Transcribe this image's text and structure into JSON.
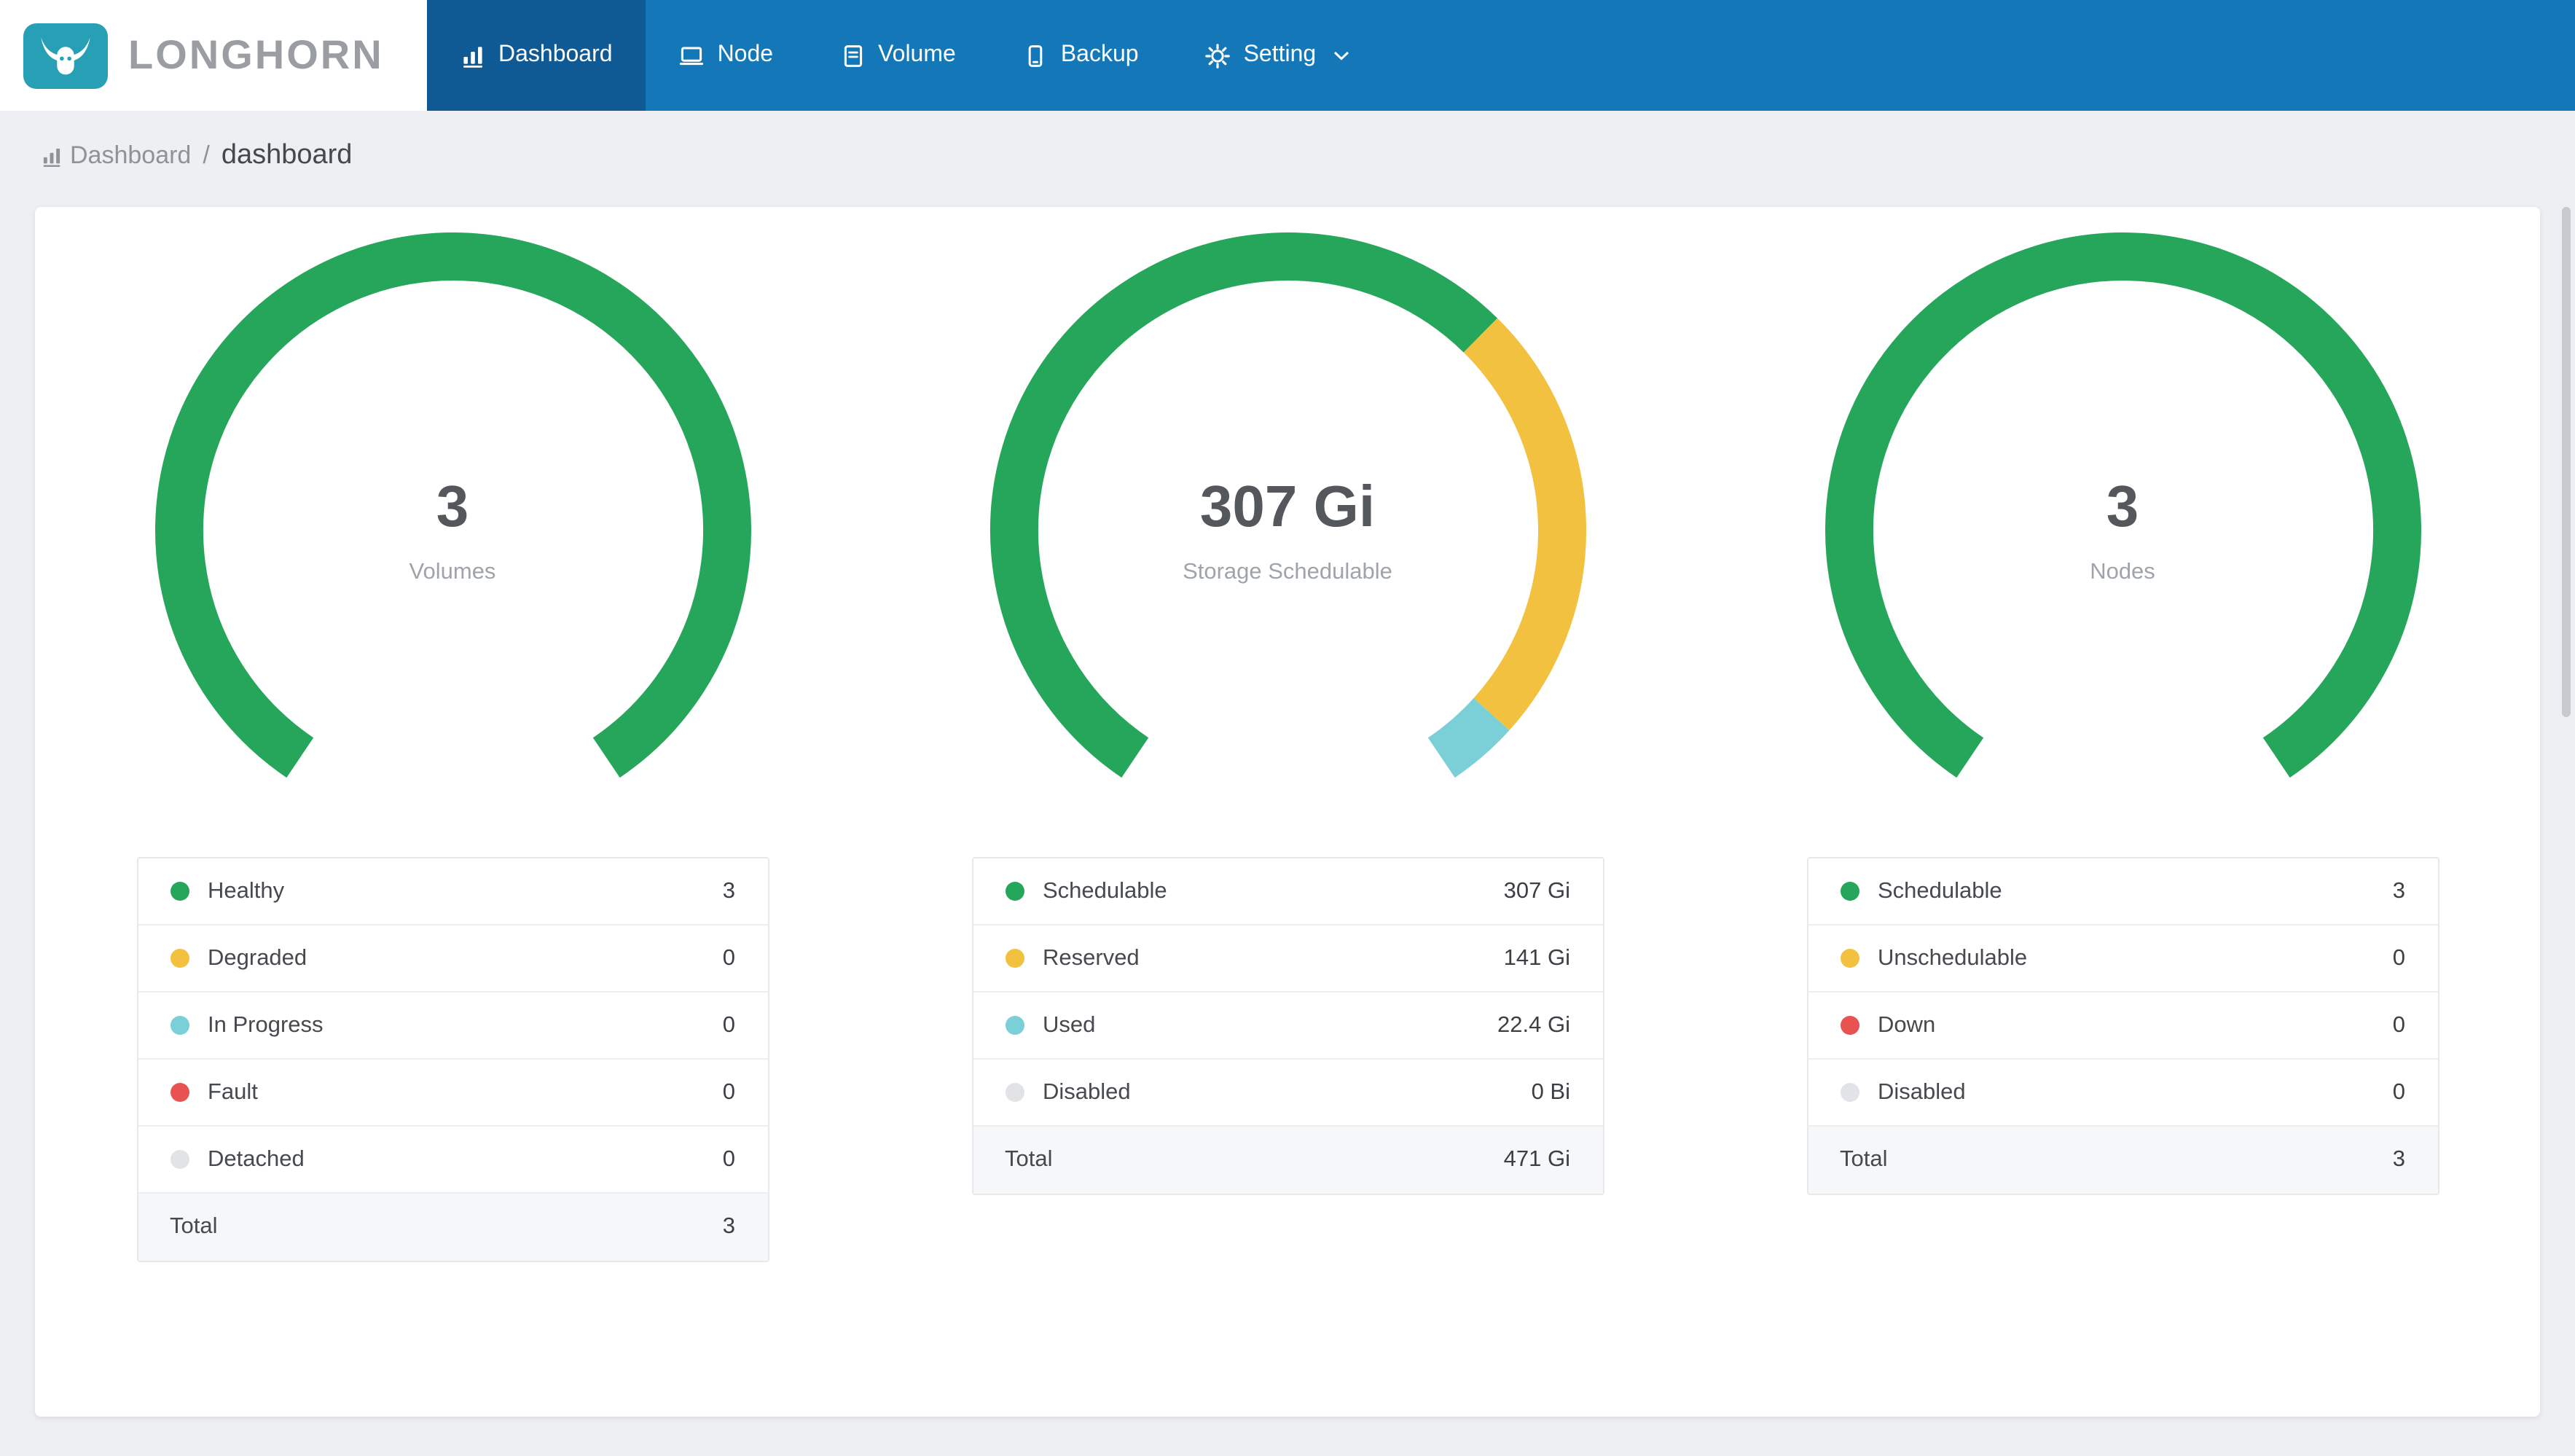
{
  "brand": {
    "name": "LONGHORN"
  },
  "nav": {
    "items": [
      {
        "label": "Dashboard",
        "icon": "bar-chart-icon",
        "active": true
      },
      {
        "label": "Node",
        "icon": "node-icon",
        "active": false
      },
      {
        "label": "Volume",
        "icon": "volume-icon",
        "active": false
      },
      {
        "label": "Backup",
        "icon": "backup-icon",
        "active": false
      },
      {
        "label": "Setting",
        "icon": "gear-icon",
        "active": false,
        "has_dropdown": true
      }
    ]
  },
  "breadcrumb": {
    "section": "Dashboard",
    "separator": "/",
    "page": "dashboard"
  },
  "palette": {
    "green": "#26A65B",
    "yellow": "#F2C140",
    "teal": "#7BCFD6",
    "red": "#E85351",
    "gray": "#E2E3E7",
    "nav_blue": "#1478B8",
    "nav_active_blue": "#0F5A94",
    "logo_teal": "#279FB5"
  },
  "chart_data": [
    {
      "type": "gauge-donut",
      "title": "Volumes",
      "center_value": "3",
      "center_label": "Volumes",
      "gap_degrees": 68,
      "segments": [
        {
          "label": "Healthy",
          "color": "green",
          "value": 3
        },
        {
          "label": "Degraded",
          "color": "yellow",
          "value": 0
        },
        {
          "label": "In Progress",
          "color": "teal",
          "value": 0
        },
        {
          "label": "Fault",
          "color": "red",
          "value": 0
        },
        {
          "label": "Detached",
          "color": "gray",
          "value": 0
        }
      ],
      "legend": [
        {
          "label": "Healthy",
          "color": "green",
          "value": "3"
        },
        {
          "label": "Degraded",
          "color": "yellow",
          "value": "0"
        },
        {
          "label": "In Progress",
          "color": "teal",
          "value": "0"
        },
        {
          "label": "Fault",
          "color": "red",
          "value": "0"
        },
        {
          "label": "Detached",
          "color": "gray",
          "value": "0"
        }
      ],
      "total": {
        "label": "Total",
        "value": "3"
      }
    },
    {
      "type": "gauge-donut",
      "title": "Storage Schedulable",
      "center_value": "307 Gi",
      "center_label": "Storage Schedulable",
      "gap_degrees": 68,
      "segments": [
        {
          "label": "Schedulable",
          "color": "green",
          "value": 307
        },
        {
          "label": "Reserved",
          "color": "yellow",
          "value": 141
        },
        {
          "label": "Used",
          "color": "teal",
          "value": 22.4
        },
        {
          "label": "Disabled",
          "color": "gray",
          "value": 0
        }
      ],
      "legend": [
        {
          "label": "Schedulable",
          "color": "green",
          "value": "307 Gi"
        },
        {
          "label": "Reserved",
          "color": "yellow",
          "value": "141 Gi"
        },
        {
          "label": "Used",
          "color": "teal",
          "value": "22.4 Gi"
        },
        {
          "label": "Disabled",
          "color": "gray",
          "value": "0 Bi"
        }
      ],
      "total": {
        "label": "Total",
        "value": "471 Gi"
      }
    },
    {
      "type": "gauge-donut",
      "title": "Nodes",
      "center_value": "3",
      "center_label": "Nodes",
      "gap_degrees": 68,
      "segments": [
        {
          "label": "Schedulable",
          "color": "green",
          "value": 3
        },
        {
          "label": "Unschedulable",
          "color": "yellow",
          "value": 0
        },
        {
          "label": "Down",
          "color": "red",
          "value": 0
        },
        {
          "label": "Disabled",
          "color": "gray",
          "value": 0
        }
      ],
      "legend": [
        {
          "label": "Schedulable",
          "color": "green",
          "value": "3"
        },
        {
          "label": "Unschedulable",
          "color": "yellow",
          "value": "0"
        },
        {
          "label": "Down",
          "color": "red",
          "value": "0"
        },
        {
          "label": "Disabled",
          "color": "gray",
          "value": "0"
        }
      ],
      "total": {
        "label": "Total",
        "value": "3"
      }
    }
  ]
}
